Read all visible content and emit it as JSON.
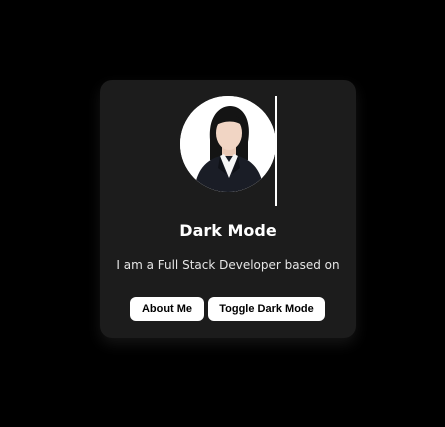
{
  "card": {
    "title": "Dark Mode",
    "subtitle": "I am a Full Stack Developer based on",
    "buttons": {
      "about_label": "About Me",
      "toggle_label": "Toggle Dark Mode"
    }
  },
  "colors": {
    "page_background": "#000000",
    "card_background": "#1c1c1c",
    "button_background": "#ffffff",
    "button_text": "#000000",
    "title_text": "#ffffff"
  }
}
